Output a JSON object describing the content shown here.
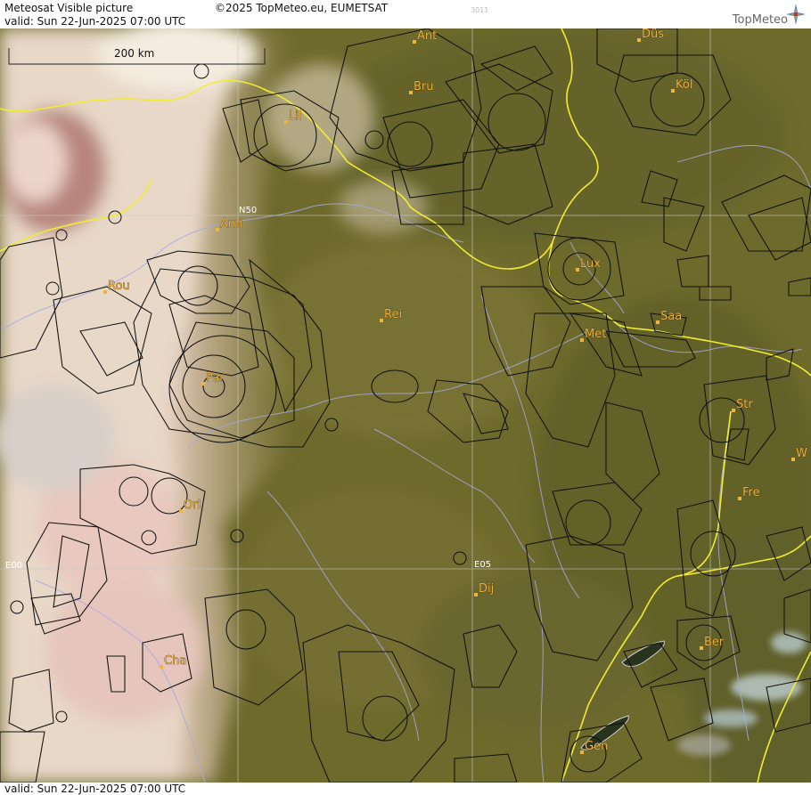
{
  "header": {
    "title": "Meteosat Visible picture",
    "valid": "valid:  Sun  22-Jun-2025  07:00 UTC",
    "copyright": "©2025 TopMeteo.eu, EUMETSAT",
    "code": "3011",
    "brand": "TopMeteo"
  },
  "footer": {
    "valid": "valid:  Sun  22-Jun-2025  07:00 UTC"
  },
  "scale": {
    "label": "200 km"
  },
  "grid_labels": {
    "lat": "N50",
    "lon0": "E00",
    "lon5": "E05"
  },
  "cities": [
    "Ant",
    "Düs",
    "Bru",
    "Köl",
    "Lil",
    "Ami",
    "Lux",
    "Rou",
    "Rei",
    "Saa",
    "Met",
    "Par",
    "Str",
    "W",
    "Fre",
    "Orl",
    "Dij",
    "Ber",
    "Cha",
    "Gen"
  ],
  "colors": {
    "terrain": "#6f6b2c",
    "cloud": "#e4d6c4",
    "border": "#f5f03a",
    "river": "#a8a8e0",
    "airspace": "#111111",
    "city": "#f0b43c"
  }
}
